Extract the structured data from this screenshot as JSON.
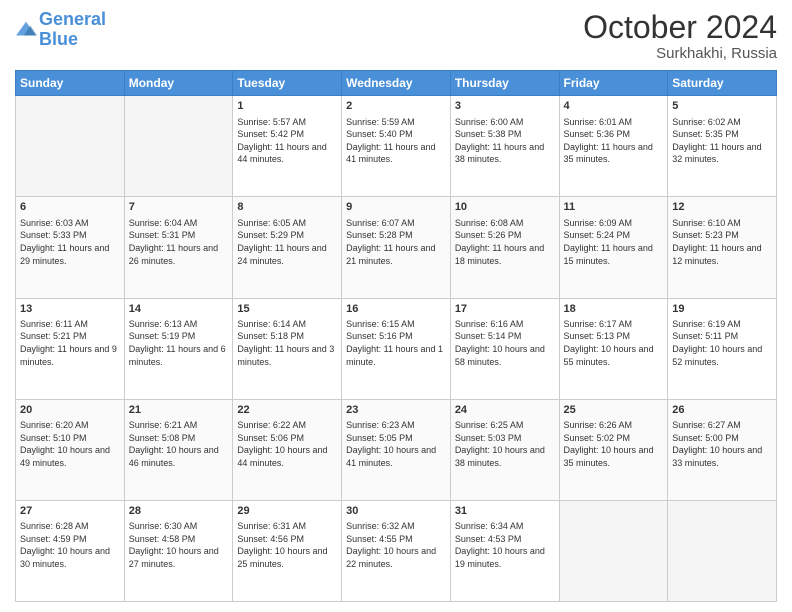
{
  "header": {
    "logo_line1": "General",
    "logo_line2": "Blue",
    "month": "October 2024",
    "location": "Surkhakhi, Russia"
  },
  "weekdays": [
    "Sunday",
    "Monday",
    "Tuesday",
    "Wednesday",
    "Thursday",
    "Friday",
    "Saturday"
  ],
  "rows": [
    [
      {
        "day": "",
        "empty": true
      },
      {
        "day": "",
        "empty": true
      },
      {
        "day": "1",
        "sunrise": "5:57 AM",
        "sunset": "5:42 PM",
        "daylight": "11 hours and 44 minutes."
      },
      {
        "day": "2",
        "sunrise": "5:59 AM",
        "sunset": "5:40 PM",
        "daylight": "11 hours and 41 minutes."
      },
      {
        "day": "3",
        "sunrise": "6:00 AM",
        "sunset": "5:38 PM",
        "daylight": "11 hours and 38 minutes."
      },
      {
        "day": "4",
        "sunrise": "6:01 AM",
        "sunset": "5:36 PM",
        "daylight": "11 hours and 35 minutes."
      },
      {
        "day": "5",
        "sunrise": "6:02 AM",
        "sunset": "5:35 PM",
        "daylight": "11 hours and 32 minutes."
      }
    ],
    [
      {
        "day": "6",
        "sunrise": "6:03 AM",
        "sunset": "5:33 PM",
        "daylight": "11 hours and 29 minutes."
      },
      {
        "day": "7",
        "sunrise": "6:04 AM",
        "sunset": "5:31 PM",
        "daylight": "11 hours and 26 minutes."
      },
      {
        "day": "8",
        "sunrise": "6:05 AM",
        "sunset": "5:29 PM",
        "daylight": "11 hours and 24 minutes."
      },
      {
        "day": "9",
        "sunrise": "6:07 AM",
        "sunset": "5:28 PM",
        "daylight": "11 hours and 21 minutes."
      },
      {
        "day": "10",
        "sunrise": "6:08 AM",
        "sunset": "5:26 PM",
        "daylight": "11 hours and 18 minutes."
      },
      {
        "day": "11",
        "sunrise": "6:09 AM",
        "sunset": "5:24 PM",
        "daylight": "11 hours and 15 minutes."
      },
      {
        "day": "12",
        "sunrise": "6:10 AM",
        "sunset": "5:23 PM",
        "daylight": "11 hours and 12 minutes."
      }
    ],
    [
      {
        "day": "13",
        "sunrise": "6:11 AM",
        "sunset": "5:21 PM",
        "daylight": "11 hours and 9 minutes."
      },
      {
        "day": "14",
        "sunrise": "6:13 AM",
        "sunset": "5:19 PM",
        "daylight": "11 hours and 6 minutes."
      },
      {
        "day": "15",
        "sunrise": "6:14 AM",
        "sunset": "5:18 PM",
        "daylight": "11 hours and 3 minutes."
      },
      {
        "day": "16",
        "sunrise": "6:15 AM",
        "sunset": "5:16 PM",
        "daylight": "11 hours and 1 minute."
      },
      {
        "day": "17",
        "sunrise": "6:16 AM",
        "sunset": "5:14 PM",
        "daylight": "10 hours and 58 minutes."
      },
      {
        "day": "18",
        "sunrise": "6:17 AM",
        "sunset": "5:13 PM",
        "daylight": "10 hours and 55 minutes."
      },
      {
        "day": "19",
        "sunrise": "6:19 AM",
        "sunset": "5:11 PM",
        "daylight": "10 hours and 52 minutes."
      }
    ],
    [
      {
        "day": "20",
        "sunrise": "6:20 AM",
        "sunset": "5:10 PM",
        "daylight": "10 hours and 49 minutes."
      },
      {
        "day": "21",
        "sunrise": "6:21 AM",
        "sunset": "5:08 PM",
        "daylight": "10 hours and 46 minutes."
      },
      {
        "day": "22",
        "sunrise": "6:22 AM",
        "sunset": "5:06 PM",
        "daylight": "10 hours and 44 minutes."
      },
      {
        "day": "23",
        "sunrise": "6:23 AM",
        "sunset": "5:05 PM",
        "daylight": "10 hours and 41 minutes."
      },
      {
        "day": "24",
        "sunrise": "6:25 AM",
        "sunset": "5:03 PM",
        "daylight": "10 hours and 38 minutes."
      },
      {
        "day": "25",
        "sunrise": "6:26 AM",
        "sunset": "5:02 PM",
        "daylight": "10 hours and 35 minutes."
      },
      {
        "day": "26",
        "sunrise": "6:27 AM",
        "sunset": "5:00 PM",
        "daylight": "10 hours and 33 minutes."
      }
    ],
    [
      {
        "day": "27",
        "sunrise": "6:28 AM",
        "sunset": "4:59 PM",
        "daylight": "10 hours and 30 minutes."
      },
      {
        "day": "28",
        "sunrise": "6:30 AM",
        "sunset": "4:58 PM",
        "daylight": "10 hours and 27 minutes."
      },
      {
        "day": "29",
        "sunrise": "6:31 AM",
        "sunset": "4:56 PM",
        "daylight": "10 hours and 25 minutes."
      },
      {
        "day": "30",
        "sunrise": "6:32 AM",
        "sunset": "4:55 PM",
        "daylight": "10 hours and 22 minutes."
      },
      {
        "day": "31",
        "sunrise": "6:34 AM",
        "sunset": "4:53 PM",
        "daylight": "10 hours and 19 minutes."
      },
      {
        "day": "",
        "empty": true
      },
      {
        "day": "",
        "empty": true
      }
    ]
  ],
  "labels": {
    "sunrise": "Sunrise:",
    "sunset": "Sunset:",
    "daylight": "Daylight:"
  }
}
